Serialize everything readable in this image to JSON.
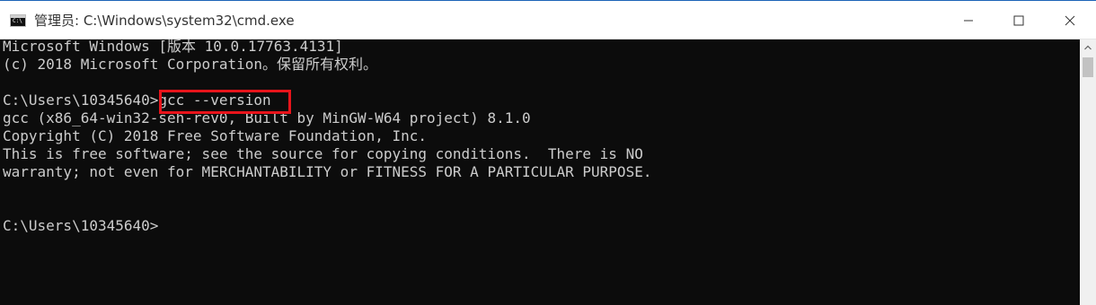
{
  "window": {
    "title": "管理员: C:\\Windows\\system32\\cmd.exe",
    "app_icon_text": "C:\\"
  },
  "controls": {
    "minimize": "minimize",
    "maximize": "maximize",
    "close": "close"
  },
  "console": {
    "lines": [
      "Microsoft Windows [版本 10.0.17763.4131]",
      "(c) 2018 Microsoft Corporation。保留所有权利。",
      "",
      "C:\\Users\\10345640>gcc --version",
      "gcc (x86_64-win32-seh-rev0, Built by MinGW-W64 project) 8.1.0",
      "Copyright (C) 2018 Free Software Foundation, Inc.",
      "This is free software; see the source for copying conditions.  There is NO",
      "warranty; not even for MERCHANTABILITY or FITNESS FOR A PARTICULAR PURPOSE.",
      "",
      "",
      "C:\\Users\\10345640>"
    ],
    "highlighted_command": "gcc --version",
    "text_color": "#cccccc",
    "background_color": "#0c0c0c",
    "highlight_color": "#e8141b"
  }
}
